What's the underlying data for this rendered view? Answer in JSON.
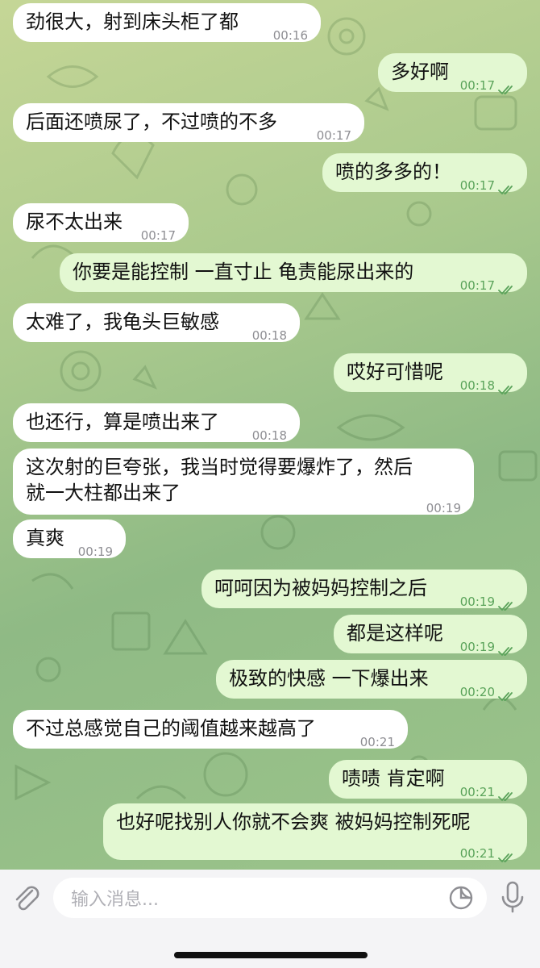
{
  "messages": [
    {
      "dir": "in",
      "text": "劲很大，射到床头柜了都",
      "time": "00:16"
    },
    {
      "dir": "out",
      "text": "多好啊",
      "time": "00:17"
    },
    {
      "dir": "in",
      "text": "后面还喷尿了，不过喷的不多",
      "time": "00:17"
    },
    {
      "dir": "out",
      "text": "喷的多多的！",
      "time": "00:17"
    },
    {
      "dir": "in",
      "text": "尿不太出来",
      "time": "00:17"
    },
    {
      "dir": "out",
      "text": "你要是能控制 一直寸止 龟责能尿出来的",
      "time": "00:17"
    },
    {
      "dir": "in",
      "text": "太难了，我龟头巨敏感",
      "time": "00:18"
    },
    {
      "dir": "out",
      "text": "哎好可惜呢",
      "time": "00:18"
    },
    {
      "dir": "in",
      "text": "也还行，算是喷出来了",
      "time": "00:18"
    },
    {
      "dir": "in",
      "line1": "这次射的巨夸张，我当时觉得要爆炸了，然后",
      "line2": "就一大柱都出来了",
      "time": "00:19"
    },
    {
      "dir": "in",
      "text": "真爽",
      "time": "00:19"
    },
    {
      "dir": "out",
      "text": "呵呵因为被妈妈控制之后",
      "time": "00:19"
    },
    {
      "dir": "out",
      "text": "都是这样呢",
      "time": "00:19"
    },
    {
      "dir": "out",
      "text": "极致的快感 一下爆出来",
      "time": "00:20"
    },
    {
      "dir": "in",
      "text": "不过总感觉自己的阈值越来越高了",
      "time": "00:21"
    },
    {
      "dir": "out",
      "text": "啧啧 肯定啊",
      "time": "00:21"
    },
    {
      "dir": "out",
      "text": "也好呢找别人你就不会爽 被妈妈控制死呢",
      "time": "00:21"
    }
  ],
  "composer": {
    "placeholder": "输入消息..."
  },
  "icons": {
    "attach": "paperclip-icon",
    "sticker": "sticker-icon",
    "voice": "microphone-icon",
    "read_status": "double-check-icon"
  },
  "colors": {
    "incoming_bubble": "#ffffff",
    "outgoing_bubble": "#e3f8d2",
    "outgoing_meta": "#5aa35a",
    "incoming_meta": "#8e8e93"
  }
}
